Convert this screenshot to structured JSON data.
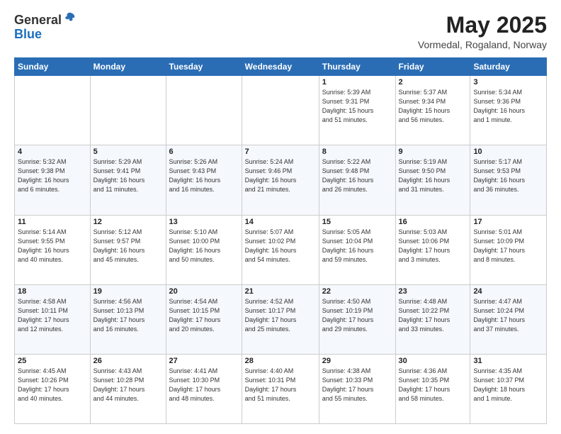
{
  "header": {
    "logo_general": "General",
    "logo_blue": "Blue",
    "month_year": "May 2025",
    "location": "Vormedal, Rogaland, Norway"
  },
  "weekdays": [
    "Sunday",
    "Monday",
    "Tuesday",
    "Wednesday",
    "Thursday",
    "Friday",
    "Saturday"
  ],
  "weeks": [
    [
      {
        "day": "",
        "info": ""
      },
      {
        "day": "",
        "info": ""
      },
      {
        "day": "",
        "info": ""
      },
      {
        "day": "",
        "info": ""
      },
      {
        "day": "1",
        "info": "Sunrise: 5:39 AM\nSunset: 9:31 PM\nDaylight: 15 hours\nand 51 minutes."
      },
      {
        "day": "2",
        "info": "Sunrise: 5:37 AM\nSunset: 9:34 PM\nDaylight: 15 hours\nand 56 minutes."
      },
      {
        "day": "3",
        "info": "Sunrise: 5:34 AM\nSunset: 9:36 PM\nDaylight: 16 hours\nand 1 minute."
      }
    ],
    [
      {
        "day": "4",
        "info": "Sunrise: 5:32 AM\nSunset: 9:38 PM\nDaylight: 16 hours\nand 6 minutes."
      },
      {
        "day": "5",
        "info": "Sunrise: 5:29 AM\nSunset: 9:41 PM\nDaylight: 16 hours\nand 11 minutes."
      },
      {
        "day": "6",
        "info": "Sunrise: 5:26 AM\nSunset: 9:43 PM\nDaylight: 16 hours\nand 16 minutes."
      },
      {
        "day": "7",
        "info": "Sunrise: 5:24 AM\nSunset: 9:46 PM\nDaylight: 16 hours\nand 21 minutes."
      },
      {
        "day": "8",
        "info": "Sunrise: 5:22 AM\nSunset: 9:48 PM\nDaylight: 16 hours\nand 26 minutes."
      },
      {
        "day": "9",
        "info": "Sunrise: 5:19 AM\nSunset: 9:50 PM\nDaylight: 16 hours\nand 31 minutes."
      },
      {
        "day": "10",
        "info": "Sunrise: 5:17 AM\nSunset: 9:53 PM\nDaylight: 16 hours\nand 36 minutes."
      }
    ],
    [
      {
        "day": "11",
        "info": "Sunrise: 5:14 AM\nSunset: 9:55 PM\nDaylight: 16 hours\nand 40 minutes."
      },
      {
        "day": "12",
        "info": "Sunrise: 5:12 AM\nSunset: 9:57 PM\nDaylight: 16 hours\nand 45 minutes."
      },
      {
        "day": "13",
        "info": "Sunrise: 5:10 AM\nSunset: 10:00 PM\nDaylight: 16 hours\nand 50 minutes."
      },
      {
        "day": "14",
        "info": "Sunrise: 5:07 AM\nSunset: 10:02 PM\nDaylight: 16 hours\nand 54 minutes."
      },
      {
        "day": "15",
        "info": "Sunrise: 5:05 AM\nSunset: 10:04 PM\nDaylight: 16 hours\nand 59 minutes."
      },
      {
        "day": "16",
        "info": "Sunrise: 5:03 AM\nSunset: 10:06 PM\nDaylight: 17 hours\nand 3 minutes."
      },
      {
        "day": "17",
        "info": "Sunrise: 5:01 AM\nSunset: 10:09 PM\nDaylight: 17 hours\nand 8 minutes."
      }
    ],
    [
      {
        "day": "18",
        "info": "Sunrise: 4:58 AM\nSunset: 10:11 PM\nDaylight: 17 hours\nand 12 minutes."
      },
      {
        "day": "19",
        "info": "Sunrise: 4:56 AM\nSunset: 10:13 PM\nDaylight: 17 hours\nand 16 minutes."
      },
      {
        "day": "20",
        "info": "Sunrise: 4:54 AM\nSunset: 10:15 PM\nDaylight: 17 hours\nand 20 minutes."
      },
      {
        "day": "21",
        "info": "Sunrise: 4:52 AM\nSunset: 10:17 PM\nDaylight: 17 hours\nand 25 minutes."
      },
      {
        "day": "22",
        "info": "Sunrise: 4:50 AM\nSunset: 10:19 PM\nDaylight: 17 hours\nand 29 minutes."
      },
      {
        "day": "23",
        "info": "Sunrise: 4:48 AM\nSunset: 10:22 PM\nDaylight: 17 hours\nand 33 minutes."
      },
      {
        "day": "24",
        "info": "Sunrise: 4:47 AM\nSunset: 10:24 PM\nDaylight: 17 hours\nand 37 minutes."
      }
    ],
    [
      {
        "day": "25",
        "info": "Sunrise: 4:45 AM\nSunset: 10:26 PM\nDaylight: 17 hours\nand 40 minutes."
      },
      {
        "day": "26",
        "info": "Sunrise: 4:43 AM\nSunset: 10:28 PM\nDaylight: 17 hours\nand 44 minutes."
      },
      {
        "day": "27",
        "info": "Sunrise: 4:41 AM\nSunset: 10:30 PM\nDaylight: 17 hours\nand 48 minutes."
      },
      {
        "day": "28",
        "info": "Sunrise: 4:40 AM\nSunset: 10:31 PM\nDaylight: 17 hours\nand 51 minutes."
      },
      {
        "day": "29",
        "info": "Sunrise: 4:38 AM\nSunset: 10:33 PM\nDaylight: 17 hours\nand 55 minutes."
      },
      {
        "day": "30",
        "info": "Sunrise: 4:36 AM\nSunset: 10:35 PM\nDaylight: 17 hours\nand 58 minutes."
      },
      {
        "day": "31",
        "info": "Sunrise: 4:35 AM\nSunset: 10:37 PM\nDaylight: 18 hours\nand 1 minute."
      }
    ]
  ]
}
